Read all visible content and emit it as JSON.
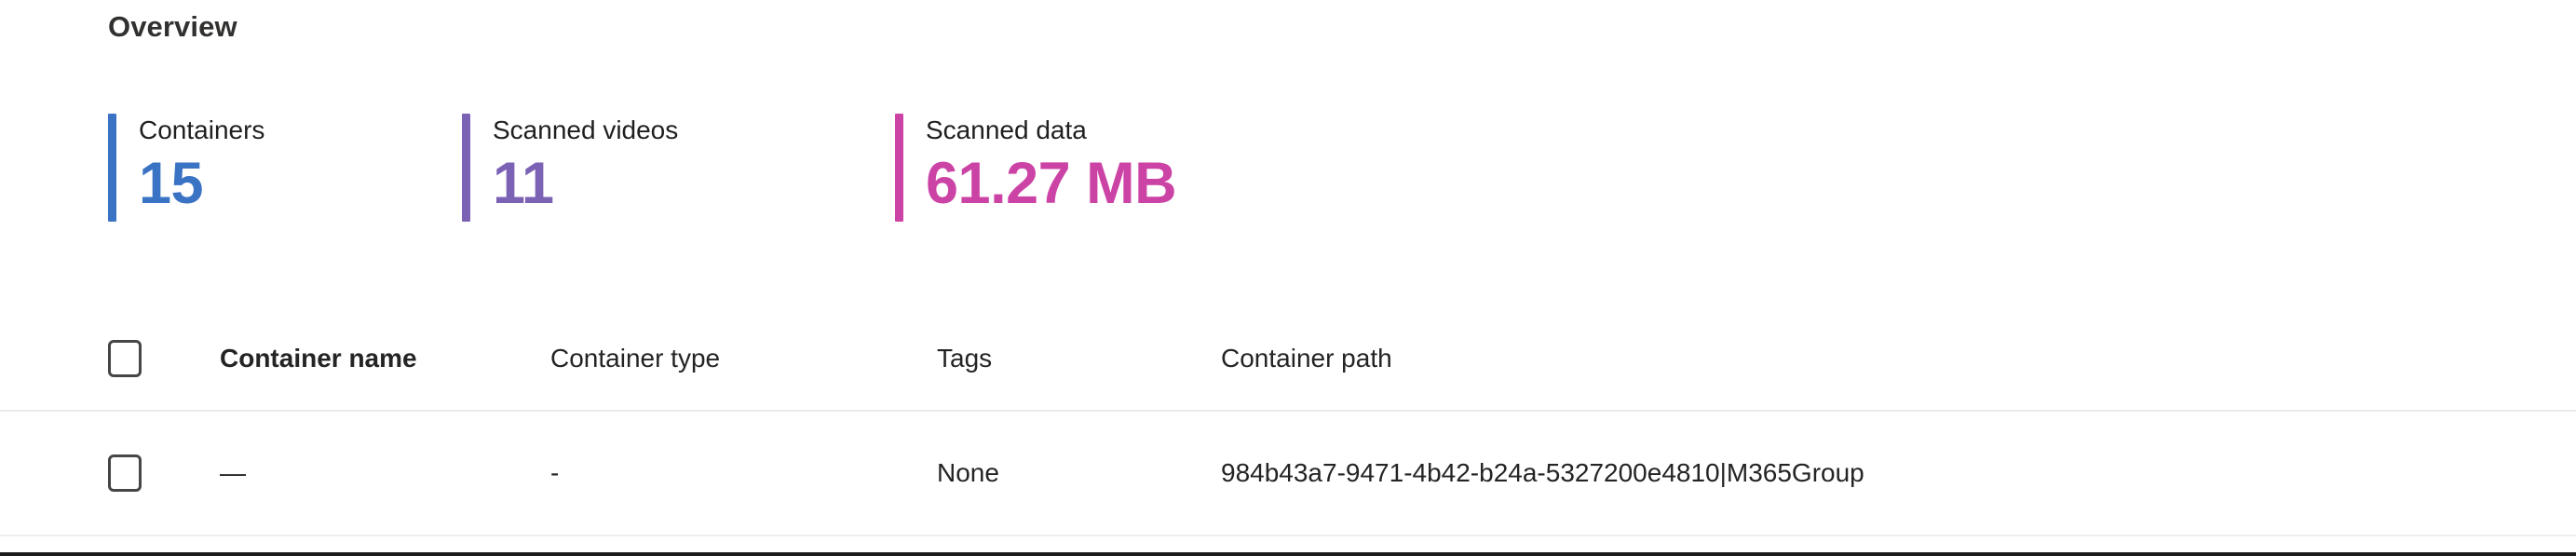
{
  "section": {
    "title": "Overview"
  },
  "metrics": [
    {
      "id": "containers",
      "label": "Containers",
      "value": "15",
      "color": "#3b73c4"
    },
    {
      "id": "scanned-videos",
      "label": "Scanned videos",
      "value": "11",
      "color": "#7b62b5"
    },
    {
      "id": "scanned-data",
      "label": "Scanned data",
      "value": "61.27 MB",
      "color": "#cc43a6"
    }
  ],
  "table": {
    "select_all_checkbox": {
      "name": "select-all",
      "checked": false
    },
    "columns": [
      {
        "key": "name",
        "label": "Container name",
        "sorted": true
      },
      {
        "key": "type",
        "label": "Container type",
        "sorted": false
      },
      {
        "key": "tags",
        "label": "Tags",
        "sorted": false
      },
      {
        "key": "path",
        "label": "Container path",
        "sorted": false
      }
    ],
    "rows": [
      {
        "checked": false,
        "name": "—",
        "type": "-",
        "tags": "None",
        "path": "984b43a7-9471-4b42-b24a-5327200e4810|M365Group"
      }
    ]
  }
}
